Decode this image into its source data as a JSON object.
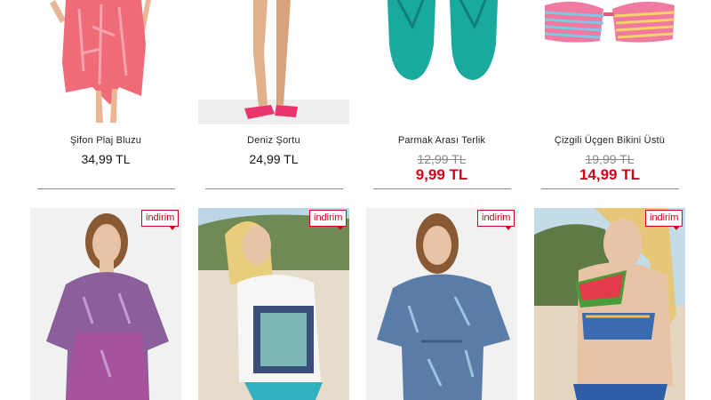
{
  "products_top": [
    {
      "name": "Şifon Plaj Bluzu",
      "price": "34,99 TL"
    },
    {
      "name": "Deniz Şortu",
      "price": "24,99 TL"
    },
    {
      "name": "Parmak Arası Terlik",
      "old_price": "12,99 TL",
      "price": "9,99 TL"
    },
    {
      "name": "Çizgili Üçgen Bikini Üstü",
      "old_price": "19,99 TL",
      "price": "14,99 TL"
    }
  ],
  "products_bottom": [
    {
      "badge": "indirim"
    },
    {
      "badge": "indirim"
    },
    {
      "badge": "indirim"
    },
    {
      "badge": "indirim"
    }
  ]
}
